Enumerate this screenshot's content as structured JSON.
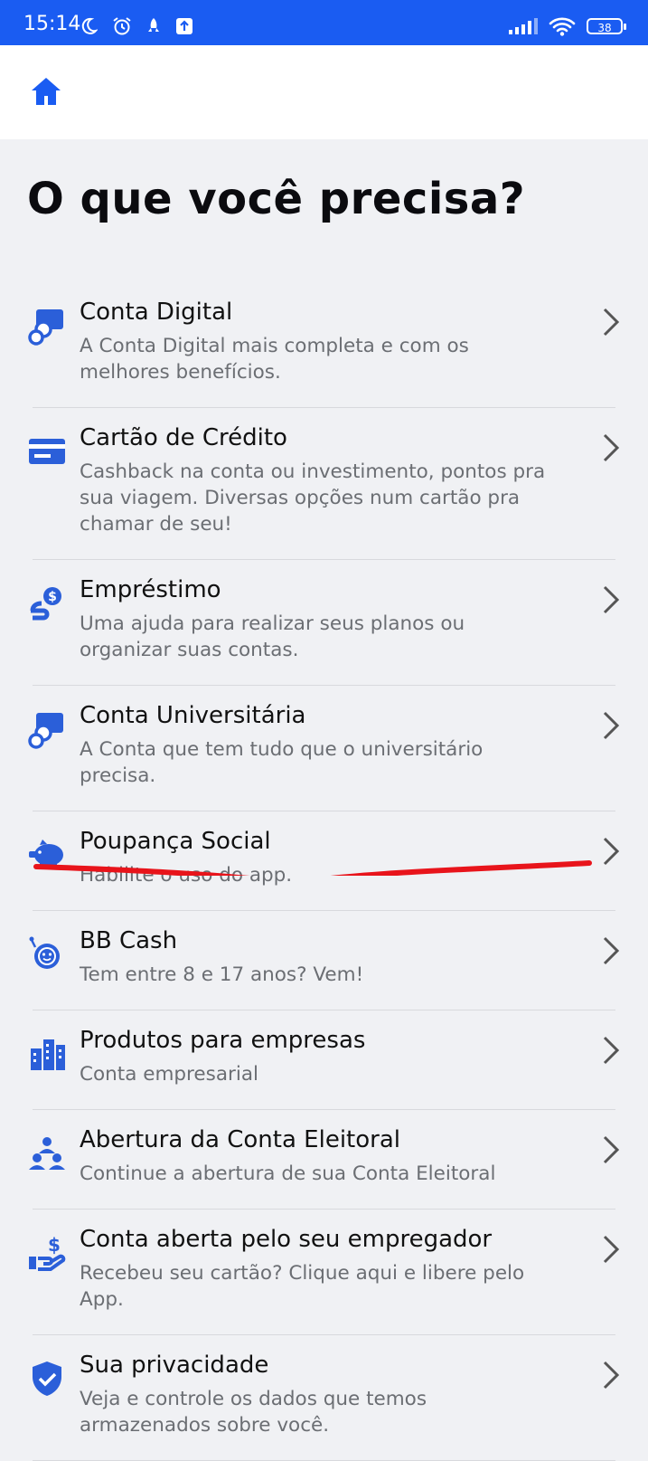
{
  "status_bar": {
    "time": "15:14",
    "battery": "38",
    "icons_left": [
      "moon-icon",
      "alarm-icon",
      "rocket-icon",
      "upload-icon"
    ],
    "icons_right": [
      "signal-icon",
      "wifi-icon",
      "battery-icon"
    ]
  },
  "header": {
    "home_icon": "home-icon"
  },
  "page": {
    "title": "O que você precisa?"
  },
  "menu": {
    "items": [
      {
        "title": "Conta Digital",
        "subtitle": "A Conta Digital mais completa e com os melhores benefícios.",
        "icon": "account-icon"
      },
      {
        "title": "Cartão de Crédito",
        "subtitle": "Cashback na conta ou investimento, pontos pra sua viagem. Diversas opções num cartão pra chamar de seu!",
        "icon": "credit-card-icon"
      },
      {
        "title": "Empréstimo",
        "subtitle": "Uma ajuda para realizar seus planos ou organizar suas contas.",
        "icon": "loan-icon"
      },
      {
        "title": "Conta Universitária",
        "subtitle": "A Conta que tem tudo que o universitário precisa.",
        "icon": "account-icon"
      },
      {
        "title": "Poupança Social",
        "subtitle": "Habilite o uso do app.",
        "icon": "piggy-bank-icon"
      },
      {
        "title": "BB Cash",
        "subtitle": "Tem entre 8 e 17 anos? Vem!",
        "icon": "kid-face-icon"
      },
      {
        "title": "Produtos para empresas",
        "subtitle": "Conta empresarial",
        "icon": "buildings-icon"
      },
      {
        "title": "Abertura da Conta Eleitoral",
        "subtitle": "Continue a abertura de sua Conta Eleitoral",
        "icon": "people-icon"
      },
      {
        "title": "Conta aberta pelo seu empregador",
        "subtitle": "Recebeu seu cartão? Clique aqui e libere pelo App.",
        "icon": "hand-money-icon"
      },
      {
        "title": "Sua privacidade",
        "subtitle": "Veja e controle os dados que temos armazenados sobre você.",
        "icon": "shield-check-icon"
      }
    ]
  },
  "colors": {
    "accent": "#1a5cf2",
    "icon": "#2b5fd9",
    "annotation": "#e8141b",
    "background": "#f0f1f4"
  }
}
